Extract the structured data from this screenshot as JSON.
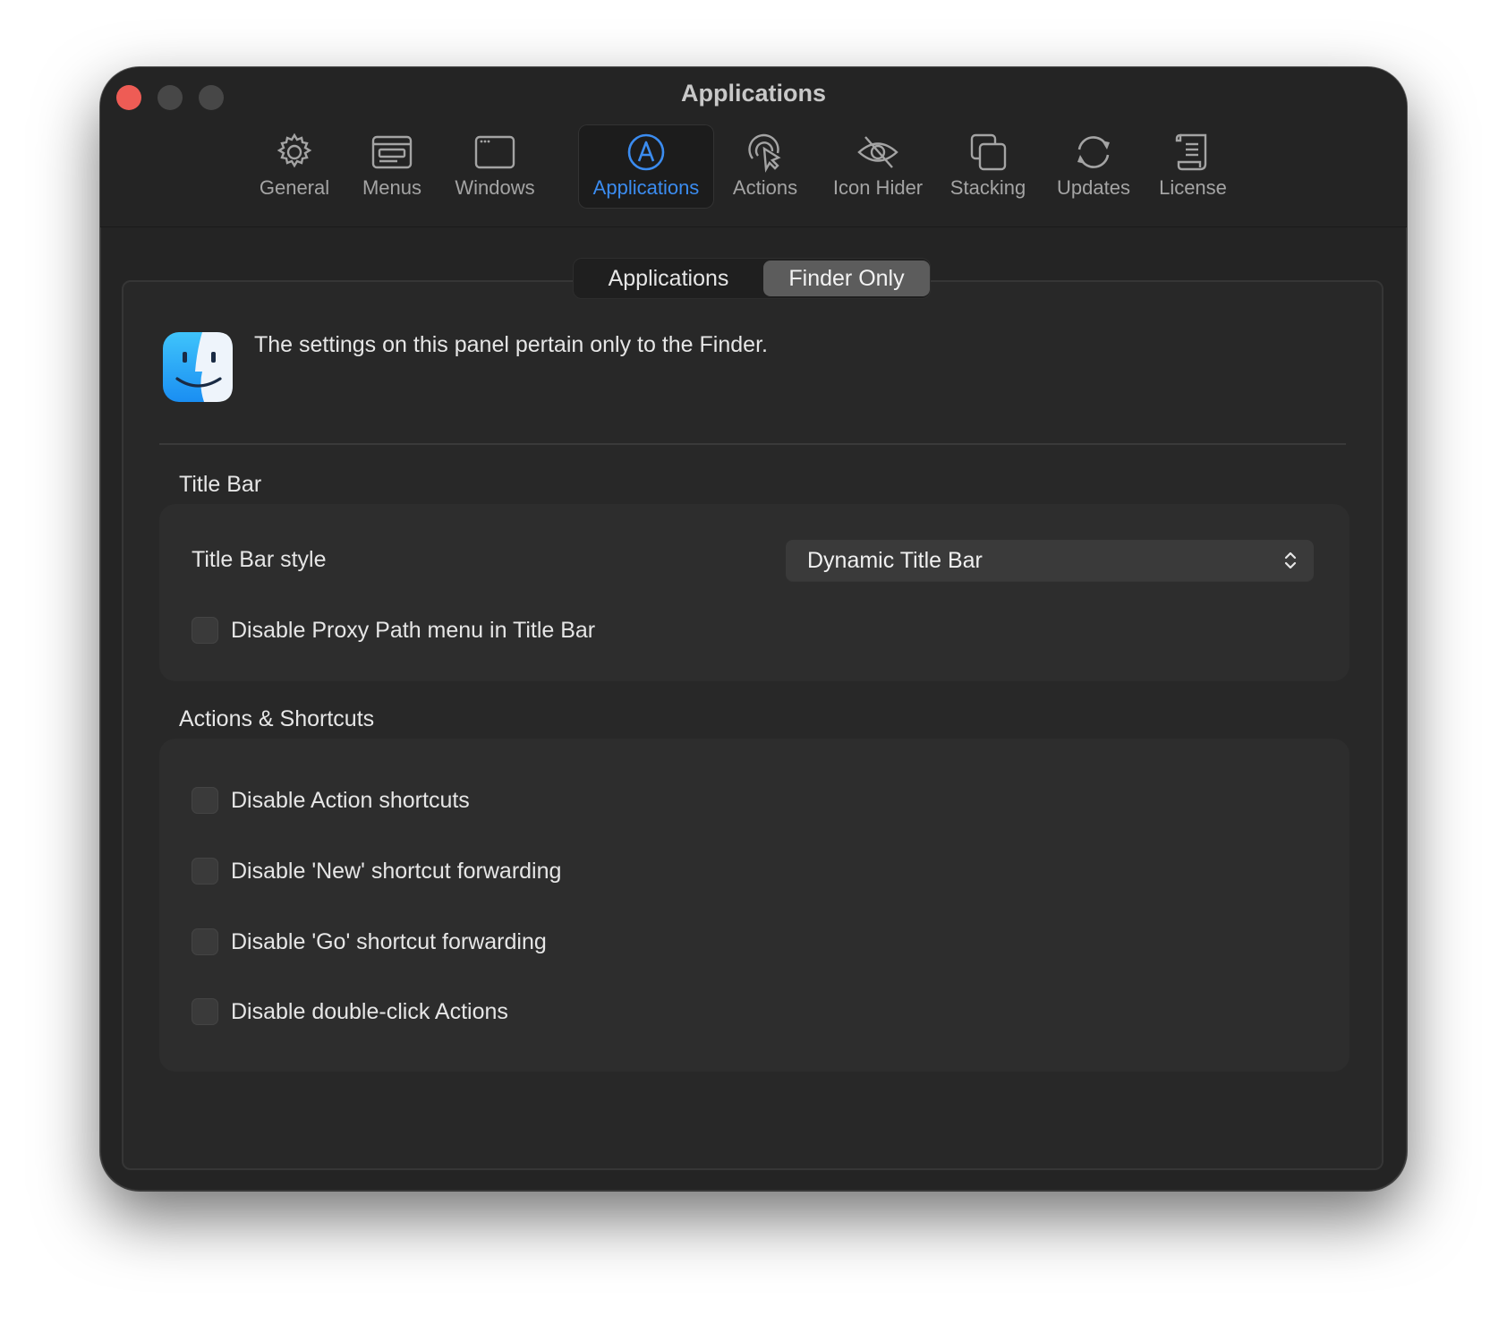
{
  "window": {
    "title": "Applications"
  },
  "toolbar": {
    "items": [
      {
        "label": "General",
        "icon": "gear-icon",
        "active": false
      },
      {
        "label": "Menus",
        "icon": "menu-bar-icon",
        "active": false
      },
      {
        "label": "Windows",
        "icon": "window-icon",
        "active": false
      },
      {
        "label": "Applications",
        "icon": "app-a-icon",
        "active": true
      },
      {
        "label": "Actions",
        "icon": "cursor-click-icon",
        "active": false
      },
      {
        "label": "Icon Hider",
        "icon": "eye-slash-icon",
        "active": false
      },
      {
        "label": "Stacking",
        "icon": "stack-icon",
        "active": false
      },
      {
        "label": "Updates",
        "icon": "refresh-icon",
        "active": false
      },
      {
        "label": "License",
        "icon": "scroll-icon",
        "active": false
      }
    ],
    "accent": "#3b8cf0"
  },
  "segmented": {
    "left": "Applications",
    "right": "Finder Only",
    "selected": "Finder Only"
  },
  "info": {
    "text": "The settings on this panel pertain only to the Finder."
  },
  "title_bar_section": {
    "heading": "Title Bar",
    "style_label": "Title Bar style",
    "style_value": "Dynamic Title Bar",
    "proxy_checkbox": "Disable Proxy Path menu in Title Bar"
  },
  "actions_section": {
    "heading": "Actions & Shortcuts",
    "checkboxes": [
      "Disable Action shortcuts",
      "Disable 'New' shortcut forwarding",
      "Disable 'Go' shortcut forwarding",
      "Disable double-click Actions"
    ]
  }
}
